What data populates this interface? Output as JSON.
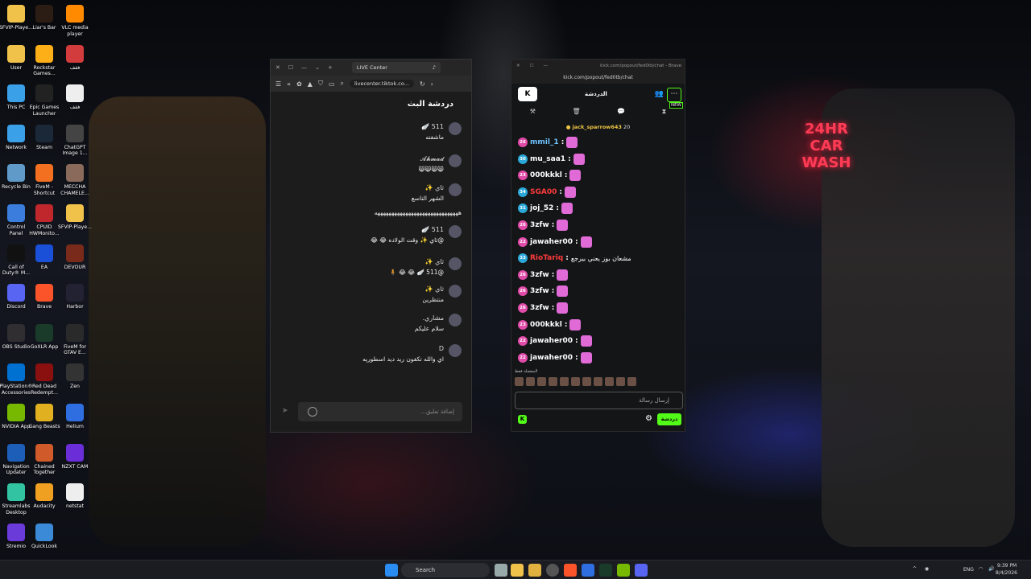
{
  "desktop": {
    "icons": [
      {
        "label": "SFVIP-Playe...",
        "color": "#f0c24a"
      },
      {
        "label": "Liar's Bar",
        "color": "#2b1d14"
      },
      {
        "label": "VLC media\nplayer",
        "color": "#ff8a00"
      },
      {
        "label": "User",
        "color": "#f0c24a"
      },
      {
        "label": "Rockstar\nGames...",
        "color": "#fcaf17"
      },
      {
        "label": "فقف",
        "color": "#d23c3c"
      },
      {
        "label": "This PC",
        "color": "#3aa0e8"
      },
      {
        "label": "Epic Games\nLauncher",
        "color": "#222"
      },
      {
        "label": "فقف",
        "color": "#eee"
      },
      {
        "label": "Network",
        "color": "#3aa0e8"
      },
      {
        "label": "Steam",
        "color": "#1b2838"
      },
      {
        "label": "ChatGPT\nImage 1...",
        "color": "#444"
      },
      {
        "label": "Recycle Bin",
        "color": "#5f9ac8"
      },
      {
        "label": "FiveM -\nShortcut",
        "color": "#f37021"
      },
      {
        "label": "MECCHA\nCHAMELE...",
        "color": "#8a6a5a"
      },
      {
        "label": "Control\nPanel",
        "color": "#3b7ddd"
      },
      {
        "label": "CPUID\nHWMonito...",
        "color": "#c0272d"
      },
      {
        "label": "SFVIP-Playe...",
        "color": "#f0c24a"
      },
      {
        "label": "Call of\nDuty® M...",
        "color": "#111"
      },
      {
        "label": "EA",
        "color": "#1a4fd8"
      },
      {
        "label": "DEVOUR",
        "color": "#7a2a1a"
      },
      {
        "label": "Discord",
        "color": "#5865f2"
      },
      {
        "label": "Brave",
        "color": "#fb542b"
      },
      {
        "label": "Harbor",
        "color": "#223"
      },
      {
        "label": "OBS Studio",
        "color": "#302e31"
      },
      {
        "label": "GoXLR App",
        "color": "#1a3a2a"
      },
      {
        "label": "FiveM for\nGTAV E...",
        "color": "#2a2a2a"
      },
      {
        "label": "PlayStation®\nAccessories",
        "color": "#0070d1"
      },
      {
        "label": "Red Dead\nRedempt...",
        "color": "#8a1010"
      },
      {
        "label": "Zen",
        "color": "#333"
      },
      {
        "label": "NVIDIA App",
        "color": "#76b900"
      },
      {
        "label": "Gang Beasts",
        "color": "#e0b020"
      },
      {
        "label": "Helium",
        "color": "#2f6ee0"
      },
      {
        "label": "Navigation\nUpdater",
        "color": "#1d5fb8"
      },
      {
        "label": "Chained\nTogether",
        "color": "#d05a2a"
      },
      {
        "label": "NZXT CAM",
        "color": "#6a2dd8"
      },
      {
        "label": "Streamlabs\nDesktop",
        "color": "#31c3a2"
      },
      {
        "label": "Audacity",
        "color": "#f0a020"
      },
      {
        "label": "netstat",
        "color": "#eee"
      },
      {
        "label": "Stremio",
        "color": "#6a3bd8"
      },
      {
        "label": "QuickLook",
        "color": "#3a8ad8"
      }
    ],
    "sign": "24HR\nCAR\nWASH"
  },
  "tiktok": {
    "tab_title": "LIVE Center",
    "url": "livecenter.tiktok.co...",
    "title": "دردشة البث",
    "comments": [
      {
        "name": "511 🪽",
        "text": "ماشفته"
      },
      {
        "name": "𝓐𝓱𝓶𝓪𝓭",
        "text": "😸😸😸😸"
      },
      {
        "name": "ثاي ✨",
        "text": "الشهر التاسع"
      },
      {
        "name": "",
        "text": "ههههههههههههههههههههههههههههههه"
      },
      {
        "name": "511 🪽",
        "text": "@ثاي ✨ وقت الولاده 😂 😂"
      },
      {
        "name": "ثاي ✨",
        "text": "@511 🪽 😂 😂 🧍"
      },
      {
        "name": "ثاي ✨",
        "text": "منتظرين"
      },
      {
        "name": "مشاري.",
        "text": "سلام عليكم"
      },
      {
        "name": "D",
        "text": "اي والله تكفون ريد ديد اسطوريه"
      }
    ],
    "input_placeholder": "إضافة تعليق..."
  },
  "kick": {
    "window_title": "kick.com/popout/fed0tb/chat - Brave",
    "address": "kick.com/popout/fed0tb/chat",
    "header_title": "الدردشة",
    "new_label": "NEW",
    "pinned": {
      "user": "jack_sparrow643",
      "count": "20"
    },
    "messages": [
      {
        "level": "26",
        "user": "mmil_1",
        "text": "",
        "lcolor": "#e04aa8",
        "ucolor": "#6ec3ff"
      },
      {
        "level": "30",
        "user": "mu_saa1",
        "text": "",
        "lcolor": "#2aa8d8",
        "ucolor": "#fff"
      },
      {
        "level": "23",
        "user": "000kkkl",
        "text": "",
        "lcolor": "#e04aa8",
        "ucolor": "#fff"
      },
      {
        "level": "34",
        "user": "SGA00",
        "text": "",
        "lcolor": "#2aa8d8",
        "ucolor": "#ff3b3b"
      },
      {
        "level": "31",
        "user": "joj_52",
        "text": "",
        "lcolor": "#2aa8d8",
        "ucolor": "#fff"
      },
      {
        "level": "26",
        "user": "3zfw",
        "text": "",
        "lcolor": "#e04aa8",
        "ucolor": "#fff"
      },
      {
        "level": "22",
        "user": "jawaher00",
        "text": "",
        "lcolor": "#e04aa8",
        "ucolor": "#fff"
      },
      {
        "level": "33",
        "user": "RioTariq",
        "text": "مشعان بوز يعني بيرجع",
        "lcolor": "#2aa8d8",
        "ucolor": "#ff3b3b"
      },
      {
        "level": "26",
        "user": "3zfw",
        "text": "",
        "lcolor": "#e04aa8",
        "ucolor": "#fff"
      },
      {
        "level": "26",
        "user": "3zfw",
        "text": "",
        "lcolor": "#e04aa8",
        "ucolor": "#fff"
      },
      {
        "level": "26",
        "user": "3zfw",
        "text": "",
        "lcolor": "#e04aa8",
        "ucolor": "#fff"
      },
      {
        "level": "23",
        "user": "000kkkl",
        "text": "",
        "lcolor": "#e04aa8",
        "ucolor": "#fff"
      },
      {
        "level": "22",
        "user": "jawaher00",
        "text": "",
        "lcolor": "#e04aa8",
        "ucolor": "#fff"
      },
      {
        "level": "22",
        "user": "jawaher00",
        "text": "",
        "lcolor": "#e04aa8",
        "ucolor": "#fff"
      }
    ],
    "favorites_label": "المفضلة فقط",
    "input_placeholder": "إرسال رسالة",
    "chat_button": "دردشة",
    "accent": "#53fc18"
  },
  "taskbar": {
    "search_label": "Search",
    "lang": "ENG",
    "time": "9:39 PM",
    "date": "8/4/2026"
  }
}
